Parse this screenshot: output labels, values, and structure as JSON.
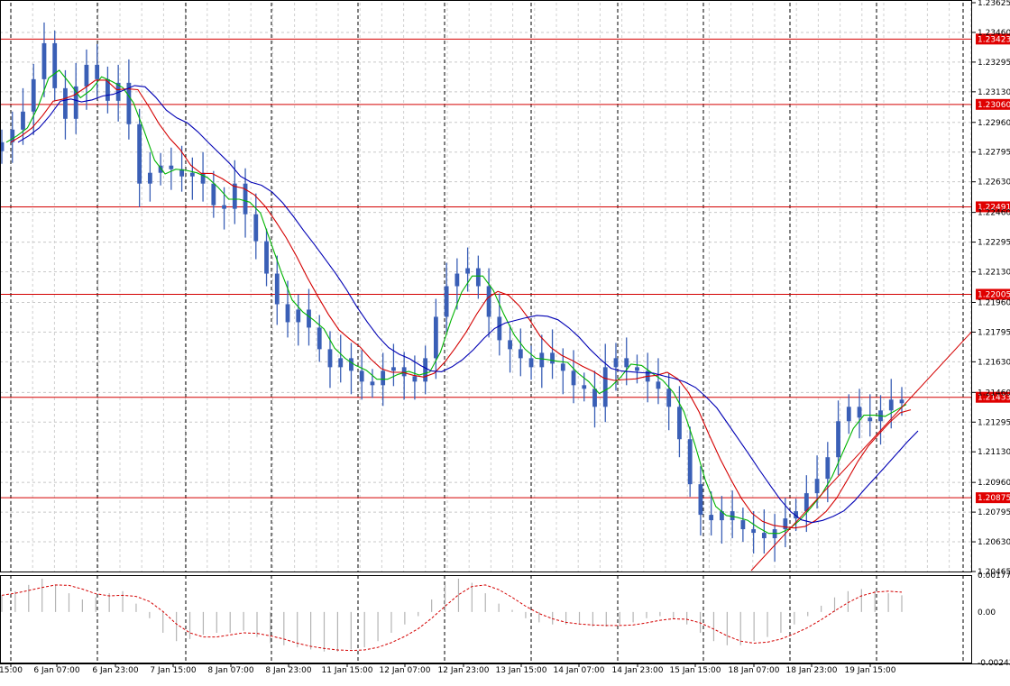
{
  "chart_data": [
    {
      "type": "candlestick",
      "symbol_hint": "",
      "title": "",
      "x_labels": [
        "15:00",
        "6 Jan 07:00",
        "6 Jan 23:00",
        "7 Jan 15:00",
        "8 Jan 07:00",
        "8 Jan 23:00",
        "11 Jan 15:00",
        "12 Jan 07:00",
        "12 Jan 23:00",
        "13 Jan 15:00",
        "14 Jan 07:00",
        "14 Jan 23:00",
        "15 Jan 15:00",
        "18 Jan 07:00",
        "18 Jan 23:00",
        "19 Jan 15:00"
      ],
      "y_ticks": [
        "1.23625",
        "1.23460",
        "1.23295",
        "1.23130",
        "1.22960",
        "1.22795",
        "1.22630",
        "1.22460",
        "1.22295",
        "1.22130",
        "1.21960",
        "1.21795",
        "1.21630",
        "1.21460",
        "1.21295",
        "1.21130",
        "1.20960",
        "1.20795",
        "1.20630",
        "1.20465"
      ],
      "ylim": [
        1.20465,
        1.23625
      ],
      "horizontal_levels": [
        "1.23423",
        "1.23060",
        "1.22491",
        "1.22005",
        "1.21433",
        "1.20875"
      ],
      "current_price": "1.21433",
      "close_approx": [
        1.2285,
        1.2292,
        1.2302,
        1.232,
        1.234,
        1.2315,
        1.2298,
        1.2316,
        1.2328,
        1.232,
        1.2308,
        1.2318,
        1.2295,
        1.2262,
        1.2268,
        1.2272,
        1.227,
        1.2266,
        1.2268,
        1.2262,
        1.225,
        1.2248,
        1.2262,
        1.2245,
        1.223,
        1.2212,
        1.2195,
        1.2185,
        1.2192,
        1.2182,
        1.217,
        1.216,
        1.2165,
        1.2158,
        1.2152,
        1.215,
        1.2158,
        1.216,
        1.2155,
        1.2152,
        1.2165,
        1.2188,
        1.2205,
        1.2212,
        1.2215,
        1.2205,
        1.2188,
        1.2175,
        1.217,
        1.2165,
        1.216,
        1.2168,
        1.2162,
        1.2158,
        1.215,
        1.2148,
        1.2138,
        1.216,
        1.2165,
        1.216,
        1.2158,
        1.2152,
        1.2148,
        1.2138,
        1.212,
        1.2095,
        1.2078,
        1.2075,
        1.208,
        1.2075,
        1.207,
        1.2068,
        1.2065,
        1.207,
        1.2076,
        1.208,
        1.209,
        1.2098,
        1.211,
        1.213,
        1.2138,
        1.2132,
        1.213,
        1.2136,
        1.2142,
        1.214
      ],
      "series": [
        {
          "name": "",
          "color": "#00b400",
          "kind": "ma-fast"
        },
        {
          "name": "",
          "color": "#d40000",
          "kind": "ma-mid"
        },
        {
          "name": "",
          "color": "#0000b4",
          "kind": "ma-slow"
        }
      ],
      "candle_color": "#3a5fb6",
      "trend_line": {
        "color": "#d40000",
        "from": [
          "18 Jan 07:00",
          1.2047
        ],
        "to": [
          "19 Jan 15:00+",
          1.218
        ]
      }
    },
    {
      "type": "histogram-oscillator",
      "y_ticks": [
        "0.00177",
        "0.00",
        "-0.00243"
      ],
      "ylim": [
        -0.00243,
        0.00177
      ],
      "values": [
        0.0008,
        0.001,
        0.0013,
        0.0016,
        0.0013,
        0.0009,
        0.0006,
        0.0007,
        0.0009,
        0.001,
        0.0004,
        -0.0003,
        -0.001,
        -0.0014,
        -0.0013,
        -0.0011,
        -0.001,
        -0.001,
        -0.0009,
        -0.0012,
        -0.0015,
        -0.0016,
        -0.0017,
        -0.0018,
        -0.0019,
        -0.0019,
        -0.0018,
        -0.0017,
        -0.0014,
        -0.001,
        -0.0006,
        -0.0002,
        0.0006,
        0.0013,
        0.0016,
        0.0014,
        0.0009,
        0.0004,
        0.0001,
        -0.0003,
        -0.0005,
        -0.0006,
        -0.0006,
        -0.0006,
        -0.0007,
        -0.0007,
        -0.0006,
        -0.0005,
        -0.0003,
        -0.0002,
        -0.0003,
        -0.0006,
        -0.001,
        -0.0014,
        -0.0016,
        -0.0016,
        -0.0014,
        -0.0012,
        -0.001,
        -0.0006,
        -0.0002,
        0.0003,
        0.0007,
        0.001,
        0.0011,
        0.001,
        0.0009,
        0.0008
      ],
      "signal_color": "#d40000",
      "bar_color": "#b4b4b4"
    }
  ]
}
